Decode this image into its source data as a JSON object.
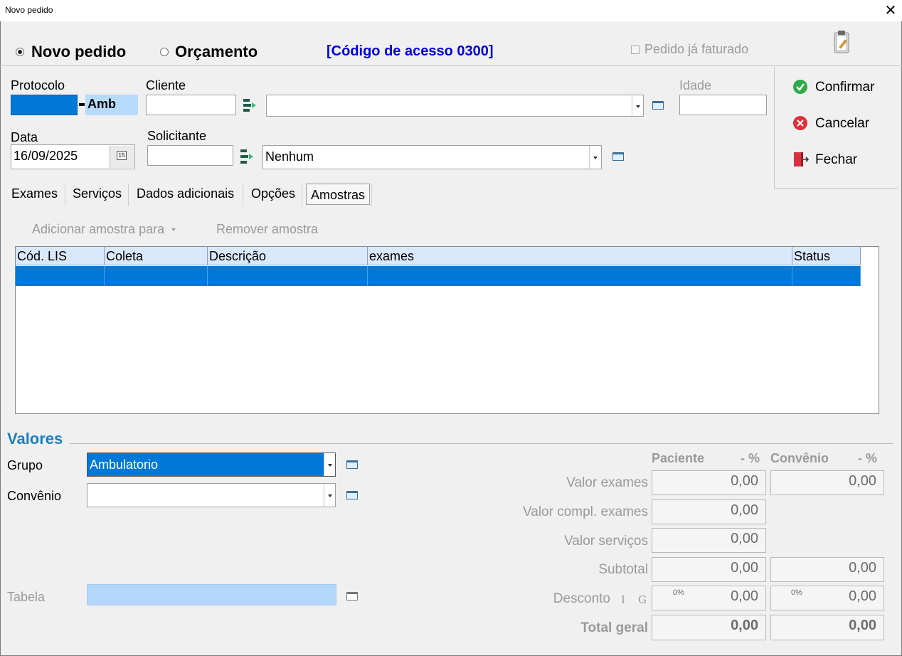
{
  "window": {
    "title": "Novo pedido",
    "close_glyph": "✕"
  },
  "mode": {
    "novo_pedido": "Novo pedido",
    "orcamento": "Orçamento",
    "access_code": "[Código de acesso 0300]",
    "faturado": "Pedido já faturado"
  },
  "form": {
    "protocolo_label": "Protocolo",
    "protocolo_suffix": "Amb",
    "cliente_label": "Cliente",
    "idade_label": "Idade",
    "data_label": "Data",
    "data_value": "16/09/2025",
    "calendar_glyph": "15",
    "solicitante_label": "Solicitante",
    "solicitante_value": "Nenhum"
  },
  "actions": {
    "confirmar": "Confirmar",
    "cancelar": "Cancelar",
    "fechar": "Fechar"
  },
  "tabs": [
    "Exames",
    "Serviços",
    "Dados adicionais",
    "Opções",
    "Amostras"
  ],
  "amostras": {
    "add_label": "Adicionar amostra para",
    "remove_label": "Remover amostra",
    "columns": [
      "Cód. LIS",
      "Coleta",
      "Descrição",
      "exames",
      "Status"
    ]
  },
  "valores": {
    "title": "Valores",
    "grupo_label": "Grupo",
    "grupo_value": "Ambulatorio",
    "convenio_label": "Convênio",
    "tabela_label": "Tabela",
    "header_paciente": "Paciente",
    "header_pct1": "- %",
    "header_convenio": "Convênio",
    "header_pct2": "- %",
    "valor_exames_label": "Valor exames",
    "valor_exames_paciente": "0,00",
    "valor_exames_convenio": "0,00",
    "valor_compl_label": "Valor compl. exames",
    "valor_compl_paciente": "0,00",
    "valor_servicos_label": "Valor serviços",
    "valor_servicos_paciente": "0,00",
    "subtotal_label": "Subtotal",
    "subtotal_paciente": "0,00",
    "subtotal_convenio": "0,00",
    "desconto_label": "Desconto",
    "desconto_i": "I",
    "desconto_g": "G",
    "desconto_pct_paciente": "0%",
    "desconto_paciente": "0,00",
    "desconto_pct_convenio": "0%",
    "desconto_convenio": "0,00",
    "total_label": "Total geral",
    "total_paciente": "0,00",
    "total_convenio": "0,00"
  }
}
